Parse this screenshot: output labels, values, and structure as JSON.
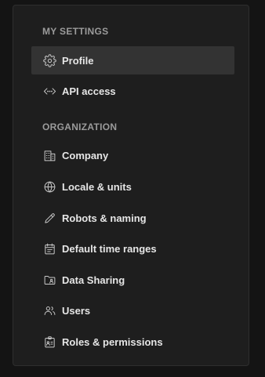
{
  "sections": {
    "my_settings": {
      "heading": "MY SETTINGS",
      "items": [
        {
          "label": "Profile",
          "icon": "gear-icon",
          "active": true
        },
        {
          "label": "API access",
          "icon": "code-icon",
          "active": false
        }
      ]
    },
    "organization": {
      "heading": "ORGANIZATION",
      "items": [
        {
          "label": "Company",
          "icon": "building-icon"
        },
        {
          "label": "Locale & units",
          "icon": "globe-icon"
        },
        {
          "label": "Robots & naming",
          "icon": "pencil-icon"
        },
        {
          "label": "Default time ranges",
          "icon": "calendar-icon"
        },
        {
          "label": "Data Sharing",
          "icon": "shared-folder-icon"
        },
        {
          "label": "Users",
          "icon": "users-icon"
        },
        {
          "label": "Roles & permissions",
          "icon": "id-badge-icon"
        }
      ]
    }
  },
  "colors": {
    "background": "#141414",
    "panel": "#1e1e1e",
    "active_item": "#333333",
    "heading_text": "#9b9b9b",
    "item_text": "#e6e6e6"
  }
}
